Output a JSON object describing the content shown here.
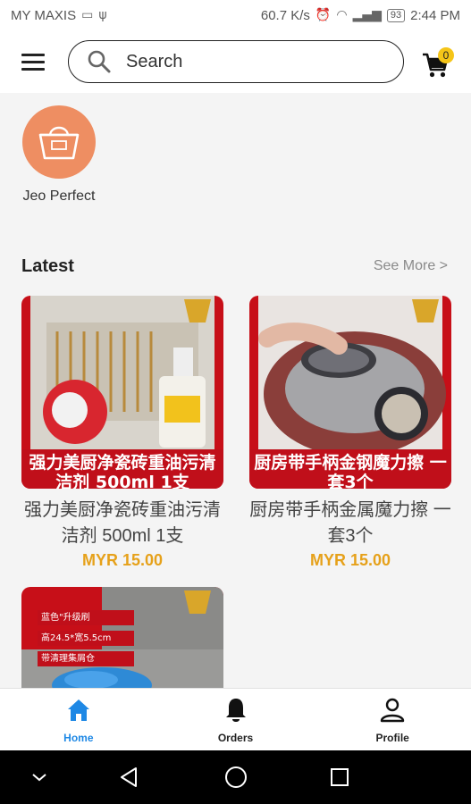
{
  "status_bar": {
    "carrier": "MY MAXIS",
    "network_speed": "60.7 K/s",
    "battery": "93",
    "time": "2:44 PM"
  },
  "header": {
    "search_placeholder": "Search",
    "cart_count": "0"
  },
  "shops": [
    {
      "name": "Jeo Perfect"
    }
  ],
  "latest": {
    "title": "Latest",
    "see_more": "See More >",
    "products": [
      {
        "name": "强力美厨净瓷砖重油污清洁剂 500ml 1支",
        "price": "MYR 15.00",
        "banner": "强力美厨净瓷砖重油污清洁剂 500ml 1支"
      },
      {
        "name": "厨房带手柄金属魔力擦 一套3个",
        "price": "MYR 15.00",
        "banner": "厨房带手柄金钢魔力擦 一套3个"
      },
      {
        "tags": [
          "蓝色\"升级刷",
          "高24.5*宽5.5cm",
          "带清理集屑仓"
        ]
      }
    ]
  },
  "bottom_nav": {
    "items": [
      {
        "label": "Home",
        "icon": "home-icon",
        "active": true
      },
      {
        "label": "Orders",
        "icon": "bell-icon",
        "active": false
      },
      {
        "label": "Profile",
        "icon": "person-icon",
        "active": false
      }
    ]
  },
  "colors": {
    "accent": "#1e88e5",
    "price": "#e6a11a",
    "shop_avatar": "#ee8e62",
    "cart_badge": "#f5c518",
    "banner_red": "#c00f1a"
  }
}
